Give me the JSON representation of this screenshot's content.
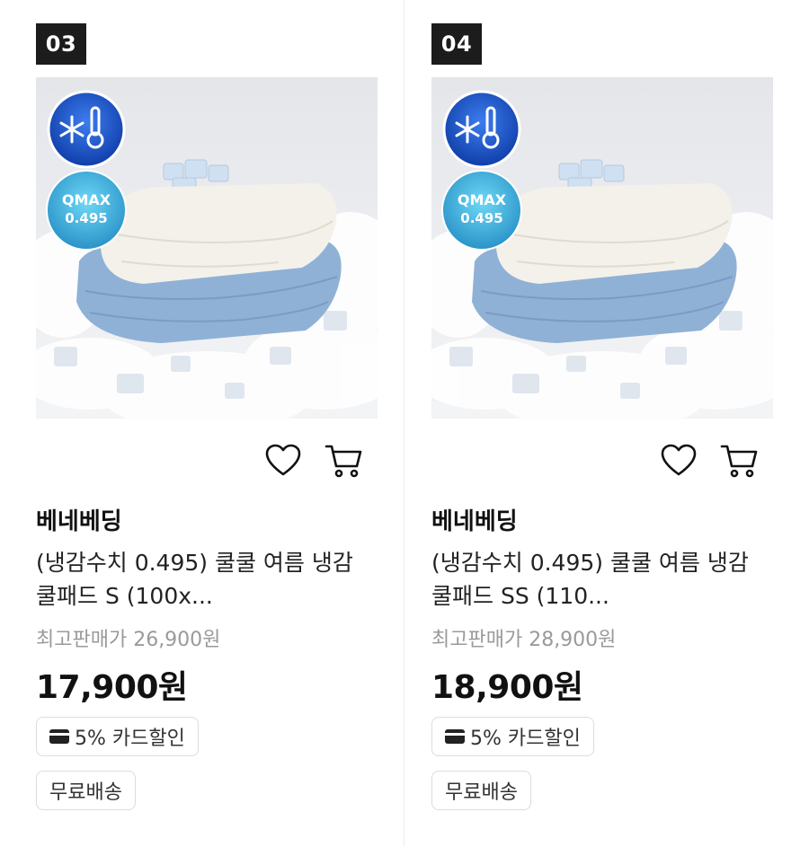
{
  "products": [
    {
      "rank": "03",
      "image": {
        "badge_icon": "snowflake-thermometer-icon",
        "badge_text_1": "QMAX",
        "badge_text_2": "0.495"
      },
      "brand": "베네베딩",
      "title": "(냉감수치 0.495) 쿨쿨 여름 냉감 쿨패드 S (100x...",
      "original_price": "최고판매가 26,900원",
      "price": "17,900원",
      "discount_tag": "5% 카드할인",
      "shipping_tag": "무료배송"
    },
    {
      "rank": "04",
      "image": {
        "badge_icon": "snowflake-thermometer-icon",
        "badge_text_1": "QMAX",
        "badge_text_2": "0.495"
      },
      "brand": "베네베딩",
      "title": "(냉감수치 0.495) 쿨쿨 여름 냉감 쿨패드 SS (110...",
      "original_price": "최고판매가 28,900원",
      "price": "18,900원",
      "discount_tag": "5% 카드할인",
      "shipping_tag": "무료배송"
    }
  ],
  "icons": {
    "wishlist": "heart-icon",
    "cart": "cart-icon",
    "card": "credit-card-icon"
  }
}
